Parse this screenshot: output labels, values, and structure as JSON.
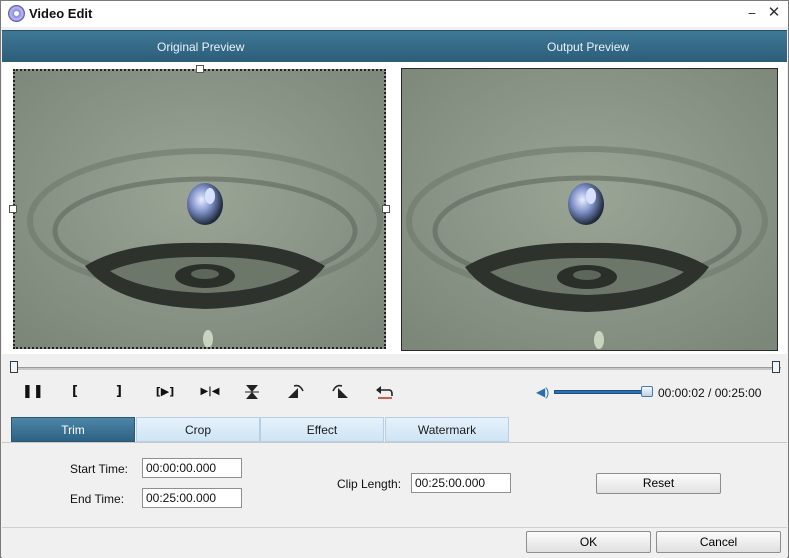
{
  "window": {
    "title": "Video Edit"
  },
  "preview": {
    "original_label": "Original Preview",
    "output_label": "Output Preview"
  },
  "controls": {
    "play_pause_icon": "pause-icon",
    "mark_in_label": "[",
    "mark_out_label": "]",
    "play_clip_label": "[▶]",
    "next_label": "▶|◀",
    "time": "00:00:02 / 00:25:00"
  },
  "tabs": [
    {
      "label": "Trim",
      "active": true
    },
    {
      "label": "Crop",
      "active": false
    },
    {
      "label": "Effect",
      "active": false
    },
    {
      "label": "Watermark",
      "active": false
    }
  ],
  "trim": {
    "start_label": "Start Time:",
    "start_value": "00:00:00.000",
    "end_label": "End Time:",
    "end_value": "00:25:00.000",
    "clip_label": "Clip Length:",
    "clip_value": "00:25:00.000",
    "reset_label": "Reset"
  },
  "footer": {
    "ok_label": "OK",
    "cancel_label": "Cancel"
  },
  "colors": {
    "header": "#2c5d79",
    "active_tab": "#3a7396",
    "volume": "#2b6fb4"
  }
}
